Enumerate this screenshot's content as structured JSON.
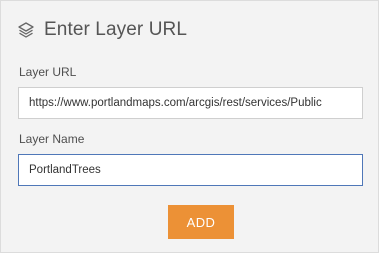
{
  "dialog": {
    "title": "Enter Layer URL",
    "title_icon": "layers-icon"
  },
  "form": {
    "url_label": "Layer URL",
    "url_value": "https://www.portlandmaps.com/arcgis/rest/services/Public",
    "name_label": "Layer Name",
    "name_value": "PortlandTrees"
  },
  "actions": {
    "add_label": "ADD"
  },
  "colors": {
    "accent": "#ec9136",
    "focus_border": "#4f77b8",
    "background": "#f3f3f3"
  }
}
